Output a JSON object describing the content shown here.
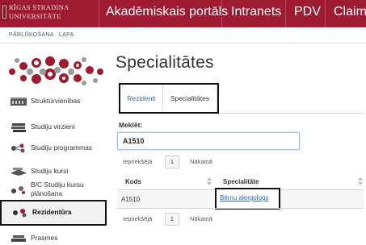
{
  "header": {
    "logo_line1": "RĪGAS STRADIŅA",
    "logo_line2": "UNIVERSITĀTE",
    "nav": [
      "Akadēmiskais portāls",
      "Intranets",
      "PDV",
      "Claims"
    ]
  },
  "breadcrumb": [
    "PĀRLŪKOŠANA",
    "LAPA"
  ],
  "sidebar": {
    "items": [
      {
        "label": "Struktūrvienības",
        "icon": "building-icon"
      },
      {
        "label": "Studiju virzieni",
        "icon": "books-icon"
      },
      {
        "label": "Studiju programmas",
        "icon": "network-icon"
      },
      {
        "label": "Studiju kursi",
        "icon": "course-icon"
      },
      {
        "label": "B/C Studiju kursu plānošana",
        "icon": "planning-icon"
      },
      {
        "label": "Rezidentūra",
        "icon": "residency-icon",
        "active": true
      },
      {
        "label": "Prasmes",
        "icon": "skills-icon"
      }
    ]
  },
  "main": {
    "title": "Specialitātes",
    "tabs": [
      {
        "label": "Rezidenti",
        "active": false
      },
      {
        "label": "Specialitātes",
        "active": true
      }
    ],
    "search": {
      "label": "Meklēt:",
      "value": "A1510"
    },
    "pager": {
      "prev": "Iepriekšējā",
      "page": "1",
      "next": "Nākamā"
    },
    "table": {
      "headers": [
        "Kods",
        "Specialitāte"
      ],
      "rows": [
        {
          "code": "A1510",
          "specialty": "Bērnu alergologs"
        }
      ]
    }
  },
  "colors": {
    "brand": "#9e1b32",
    "link": "#2b6cb0",
    "highlight_border": "#111111"
  }
}
